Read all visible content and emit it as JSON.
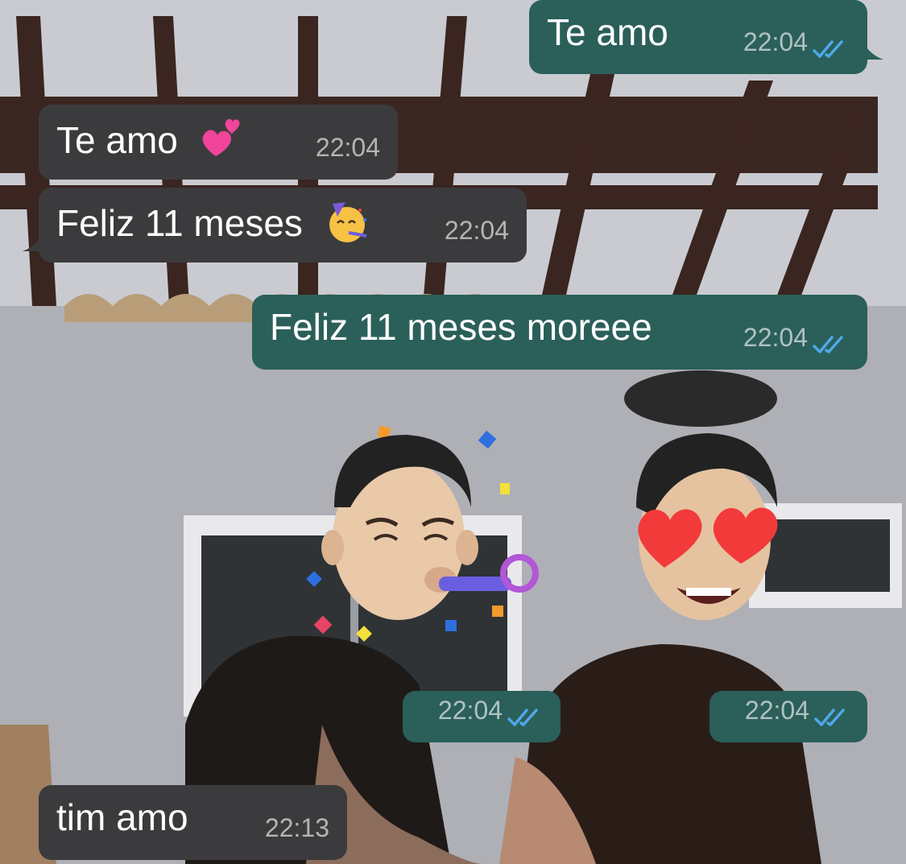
{
  "chat": {
    "messages": [
      {
        "id": "m1",
        "direction": "outgoing",
        "text": "Te amo",
        "time": "22:04",
        "status": "read"
      },
      {
        "id": "m2",
        "direction": "incoming",
        "text": "Te amo",
        "emoji": "two-hearts",
        "time": "22:04"
      },
      {
        "id": "m3",
        "direction": "incoming",
        "text": "Feliz 11 meses",
        "emoji": "partying-face",
        "time": "22:04"
      },
      {
        "id": "m4",
        "direction": "outgoing",
        "text": "Feliz 11 meses moreee",
        "time": "22:04",
        "status": "read"
      },
      {
        "id": "m5",
        "direction": "outgoing",
        "type": "sticker",
        "sticker": "memoji-party-horn",
        "time": "22:04",
        "status": "read"
      },
      {
        "id": "m6",
        "direction": "outgoing",
        "type": "sticker",
        "sticker": "memoji-heart-eyes",
        "time": "22:04",
        "status": "read"
      },
      {
        "id": "m7",
        "direction": "incoming",
        "text": "tim amo",
        "time": "22:13"
      }
    ]
  },
  "colors": {
    "outgoing_bubble": "#2b5f5a",
    "incoming_bubble": "#3b3b3d",
    "read_ticks": "#4fa8e8"
  },
  "icons": {
    "read_status": "double-check-icon",
    "two_hearts": "two-hearts-emoji",
    "party": "partying-face-emoji"
  }
}
